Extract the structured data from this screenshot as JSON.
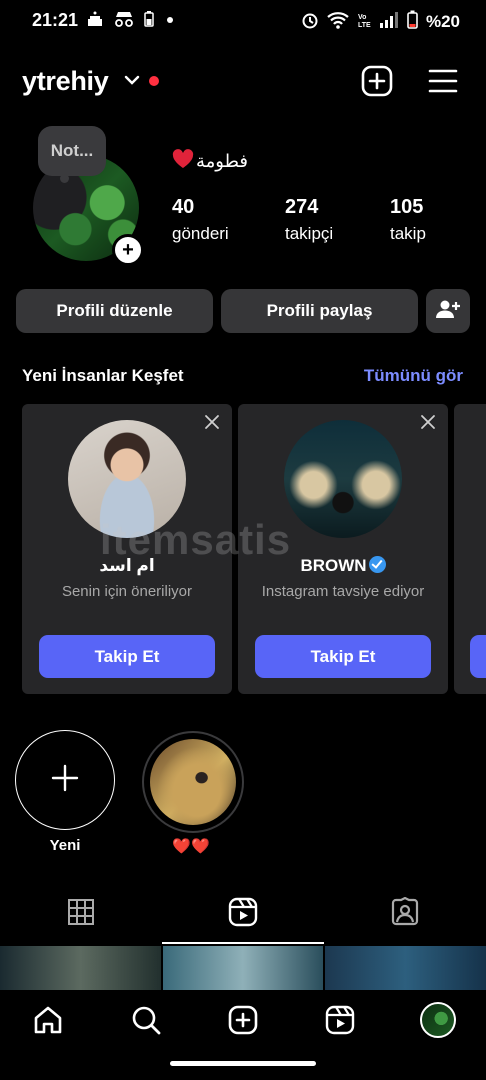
{
  "status_bar": {
    "time": "21:21",
    "battery_text": "%20",
    "left_icons": [
      "cake-icon",
      "incognito-icon",
      "battery-saver-icon",
      "dot-icon"
    ],
    "right_icons": [
      "alarm-icon",
      "wifi-icon",
      "volte-icon",
      "signal-icon",
      "battery-icon"
    ]
  },
  "header": {
    "username": "ytrehiy",
    "icons": [
      "chevron-down-icon",
      "create-post-icon",
      "menu-icon"
    ]
  },
  "profile": {
    "note": "Not...",
    "display_name": "فطومة",
    "stats": [
      {
        "value": "40",
        "label": "gönderi"
      },
      {
        "value": "274",
        "label": "takipçi"
      },
      {
        "value": "105",
        "label": "takip"
      }
    ]
  },
  "actions": {
    "edit_profile": "Profili düzenle",
    "share_profile": "Profili paylaş"
  },
  "discover": {
    "title": "Yeni İnsanlar Keşfet",
    "see_all": "Tümünü gör",
    "cards": [
      {
        "name": "ام اسد",
        "subtitle": "Senin için öneriliyor",
        "button": "Takip Et",
        "verified": false
      },
      {
        "name": "BROWN",
        "subtitle": "Instagram tavsiye ediyor",
        "button": "Takip Et",
        "verified": true
      }
    ]
  },
  "highlights": {
    "new_label": "Yeni",
    "items": [
      {
        "label": "❤️❤️"
      }
    ]
  },
  "watermark": "itemsatis",
  "colors": {
    "accent": "#5865f7",
    "link": "#7c8cff",
    "button_bg": "#363638",
    "card_bg": "#262628"
  }
}
